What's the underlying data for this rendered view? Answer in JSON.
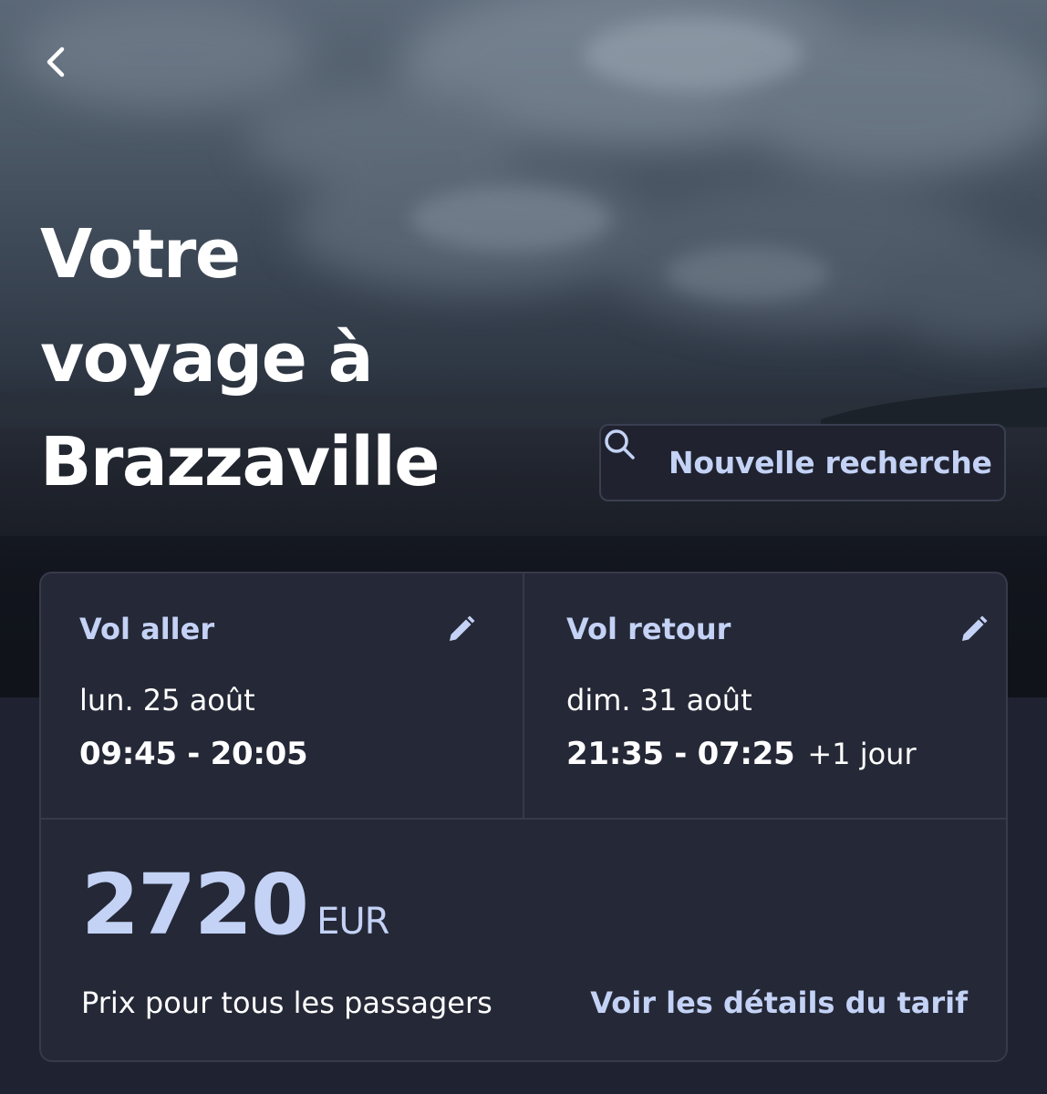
{
  "header": {
    "title_lines": [
      "Votre",
      "voyage à",
      "Brazzaville"
    ],
    "back_icon": "chevron-left-icon"
  },
  "new_search": {
    "label": "Nouvelle recherche",
    "icon": "search-icon"
  },
  "flights": {
    "outbound": {
      "heading": "Vol aller",
      "date": "lun. 25 août",
      "times": "09:45 - 20:05",
      "edit_icon": "pencil-icon"
    },
    "return": {
      "heading": "Vol retour",
      "date": "dim. 31 août",
      "times": "21:35 - 07:25",
      "day_offset": "+1 jour",
      "edit_icon": "pencil-icon"
    }
  },
  "price": {
    "amount": "2720",
    "currency": "EUR",
    "caption": "Prix pour tous les passagers",
    "details_link": "Voir les détails du tarif"
  },
  "colors": {
    "accent": "#c3d2f5",
    "card_background": "#252836",
    "page_background": "#1f2230",
    "card_border": "#363a4b"
  }
}
